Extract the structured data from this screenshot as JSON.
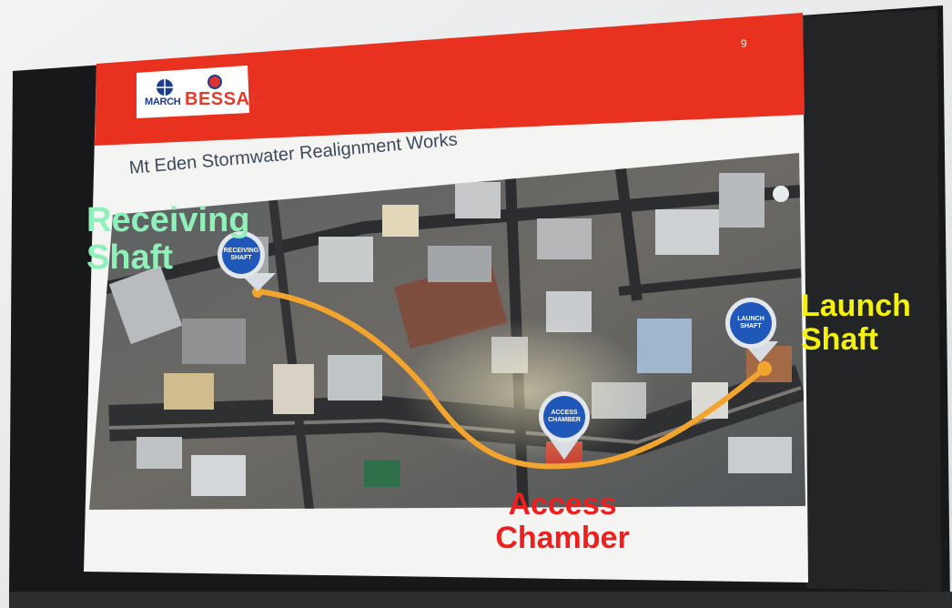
{
  "slide": {
    "page_number": "9",
    "logo_left": "MARCH",
    "logo_right": "BESSAC",
    "title": "Mt Eden Stormwater Realignment Works"
  },
  "pins": {
    "receiving": "RECEIVING SHAFT",
    "access": "ACCESS CHAMBER",
    "launch": "LAUNCH SHAFT"
  },
  "overlay_labels": {
    "receiving": "Receiving Shaft",
    "launch": "Launch Shaft",
    "access": "Access Chamber"
  },
  "colors": {
    "slide_header_red": "#e8321f",
    "route_orange": "#f2a52e",
    "pin_blue": "#1f58b9",
    "receiving_label": "#8ff0b9",
    "launch_label": "#f4f10d",
    "access_label": "#ee1f1f"
  }
}
